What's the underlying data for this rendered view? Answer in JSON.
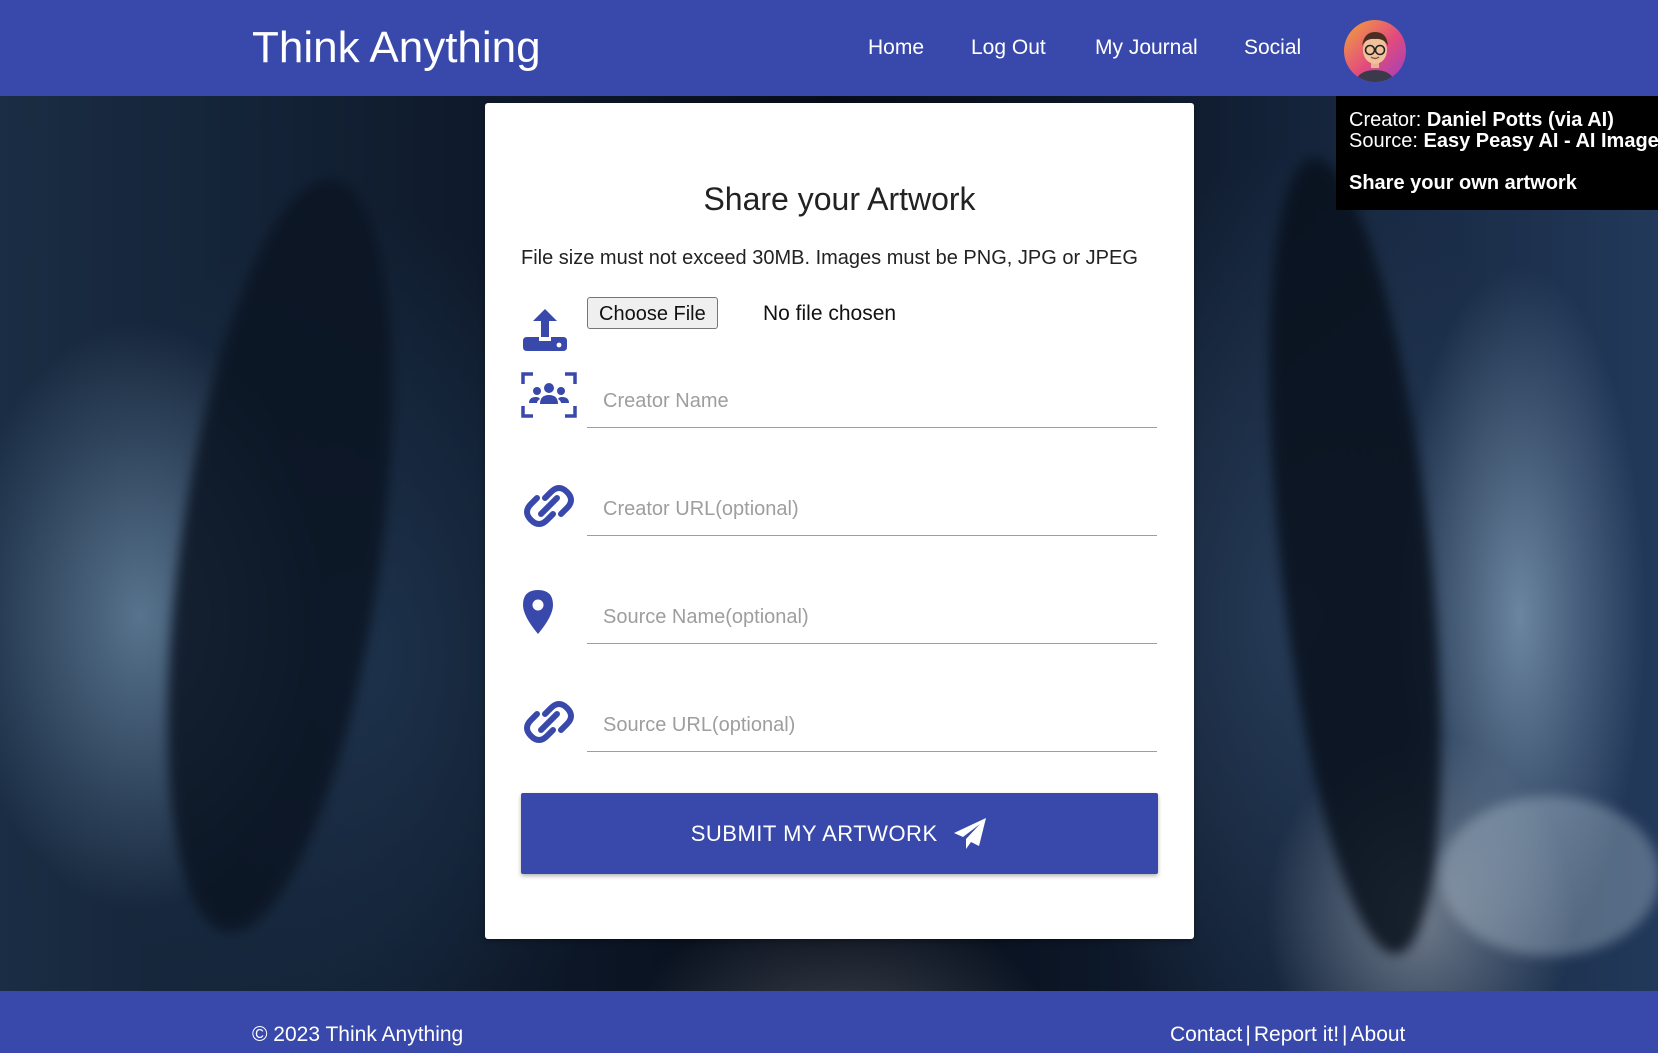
{
  "header": {
    "brand": "Think Anything",
    "nav": [
      "Home",
      "Log Out",
      "My Journal",
      "Social"
    ]
  },
  "info_box": {
    "creator_label": "Creator:",
    "creator_value": "Daniel Potts (via AI)",
    "source_label": "Source:",
    "source_value": "Easy Peasy AI - AI Images",
    "share_link": "Share your own artwork"
  },
  "form": {
    "title": "Share your Artwork",
    "notice": "File size must not exceed 30MB. Images must be PNG, JPG or JPEG",
    "file_button": "Choose File",
    "file_status": "No file chosen",
    "creator_name_placeholder": "Creator Name",
    "creator_url_placeholder": "Creator URL(optional)",
    "source_name_placeholder": "Source Name(optional)",
    "source_url_placeholder": "Source URL(optional)",
    "submit_label": "SUBMIT MY ARTWORK"
  },
  "footer": {
    "copyright": "© 2023 Think Anything",
    "links": [
      "Contact",
      "Report it!",
      "About"
    ],
    "separator": "|"
  },
  "colors": {
    "primary": "#3949ab",
    "info_bg": "#000000"
  },
  "icons": {
    "upload": "upload-icon",
    "creator": "people-scan-icon",
    "creator_url": "link-icon",
    "source_name": "location-pin-icon",
    "source_url": "link-icon",
    "submit": "paper-plane-icon"
  }
}
